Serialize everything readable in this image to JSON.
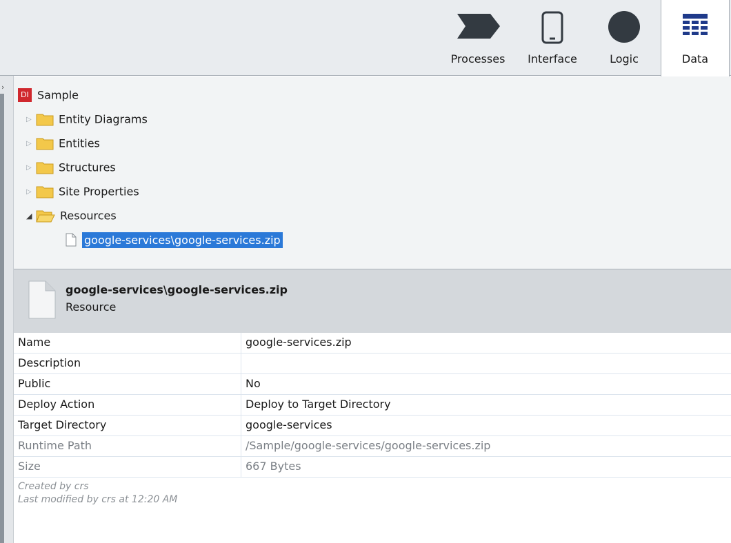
{
  "toolbar": {
    "tabs": [
      {
        "label": "Processes",
        "icon": "processes-chevron-icon"
      },
      {
        "label": "Interface",
        "icon": "phone-icon"
      },
      {
        "label": "Logic",
        "icon": "circle-icon"
      },
      {
        "label": "Data",
        "icon": "data-grid-icon",
        "active": true
      }
    ]
  },
  "tree": {
    "root": "Sample",
    "items": [
      {
        "label": "Entity Diagrams",
        "expanded": false
      },
      {
        "label": "Entities",
        "expanded": false
      },
      {
        "label": "Structures",
        "expanded": false
      },
      {
        "label": "Site Properties",
        "expanded": false
      },
      {
        "label": "Resources",
        "expanded": true
      }
    ],
    "selected_file": "google-services\\google-services.zip"
  },
  "detail": {
    "title": "google-services\\google-services.zip",
    "subtitle": "Resource"
  },
  "properties": [
    {
      "name": "Name",
      "value": "google-services.zip"
    },
    {
      "name": "Description",
      "value": ""
    },
    {
      "name": "Public",
      "value": "No"
    },
    {
      "name": "Deploy Action",
      "value": "Deploy to Target Directory"
    },
    {
      "name": "Target Directory",
      "value": "google-services"
    },
    {
      "name": "Runtime Path",
      "value": "/Sample/google-services/google-services.zip"
    },
    {
      "name": "Size",
      "value": "667 Bytes"
    }
  ],
  "footer": {
    "created": "Created by crs",
    "modified": "Last modified by crs at 12:20 AM"
  },
  "colors": {
    "selection": "#2b79d8",
    "toolbar_bg": "#e9ecef",
    "tree_bg": "#f2f4f5",
    "detail_header_bg": "#d4d8dc",
    "icon_dark": "#333a41",
    "data_icon_blue": "#1f3a8a",
    "logo_red": "#d0282e",
    "folder_yellow": "#f3c84a"
  }
}
